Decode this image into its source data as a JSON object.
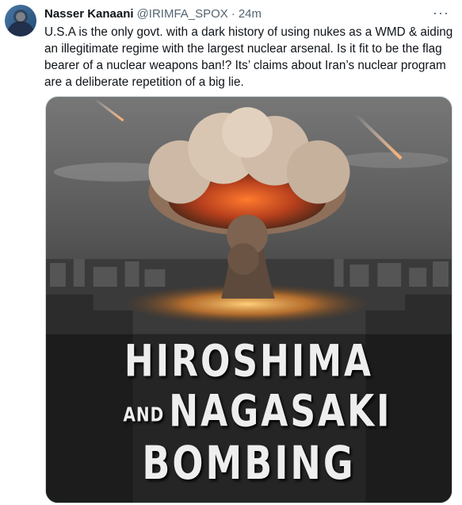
{
  "tweet": {
    "author_name": "Nasser Kanaani",
    "handle": "@IRIMFA_SPOX",
    "separator": "·",
    "time": "24m",
    "more_label": "···",
    "text_lines": [
      "U.S.A is the only govt. with a dark history of using nukes as a WMD & aiding",
      "an illegitimate regime with the largest nuclear arsenal. Is it fit to be the flag",
      "bearer of a nuclear weapons ban!? Its’ claims about Iran’s nuclear program",
      "are a deliberate repetition of a big lie."
    ]
  },
  "media": {
    "line1": "HIROSHIMA",
    "line2_small": "AND",
    "line2_big": "NAGASAKI",
    "line3": "BOMBING"
  }
}
